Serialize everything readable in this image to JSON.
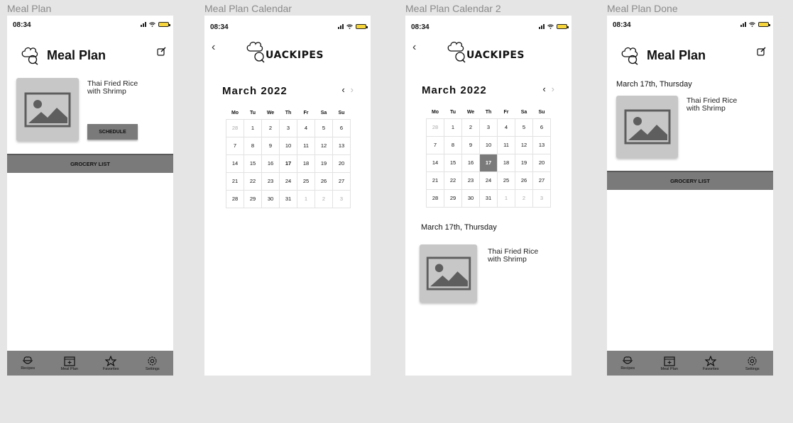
{
  "frames": {
    "f1": "Meal Plan",
    "f2": "Meal Plan Calendar",
    "f3": "Meal Plan Calendar 2",
    "f4": "Meal Plan Done"
  },
  "status": {
    "time": "08:34"
  },
  "meal_plan": {
    "title": "Meal Plan",
    "meal": "Thai Fried Rice\nwith Shrimp",
    "schedule_label": "SCHEDULE",
    "grocery_label": "GROCERY LIST"
  },
  "logo": {
    "text": "UACKIPES"
  },
  "calendar": {
    "month": "March 2022",
    "weekdays": [
      "Mo",
      "Tu",
      "We",
      "Th",
      "Fr",
      "Sa",
      "Su"
    ],
    "weeks": [
      [
        "28",
        "1",
        "2",
        "3",
        "4",
        "5",
        "6"
      ],
      [
        "7",
        "8",
        "9",
        "10",
        "11",
        "12",
        "13"
      ],
      [
        "14",
        "15",
        "16",
        "17",
        "18",
        "19",
        "20"
      ],
      [
        "21",
        "22",
        "23",
        "24",
        "25",
        "26",
        "27"
      ],
      [
        "28",
        "29",
        "30",
        "31",
        "1",
        "2",
        "3"
      ]
    ]
  },
  "selected": {
    "date_label": "March 17th, Thursday",
    "meal": "Thai Fried Rice\nwith Shrimp"
  },
  "done": {
    "title": "Meal Plan",
    "date_label": "March 17th, Thursday",
    "meal": "Thai Fried Rice\nwith Shrimp",
    "grocery_label": "GROCERY LIST"
  },
  "tabs": [
    {
      "label": "Recipes",
      "icon": "bowl-icon"
    },
    {
      "label": "Meal Plan",
      "icon": "calendar-add-icon"
    },
    {
      "label": "Favorites",
      "icon": "star-icon"
    },
    {
      "label": "Settings",
      "icon": "gear-icon"
    }
  ],
  "colors": {
    "accent": "#7a7a7a",
    "battery": "#f5d53b"
  }
}
